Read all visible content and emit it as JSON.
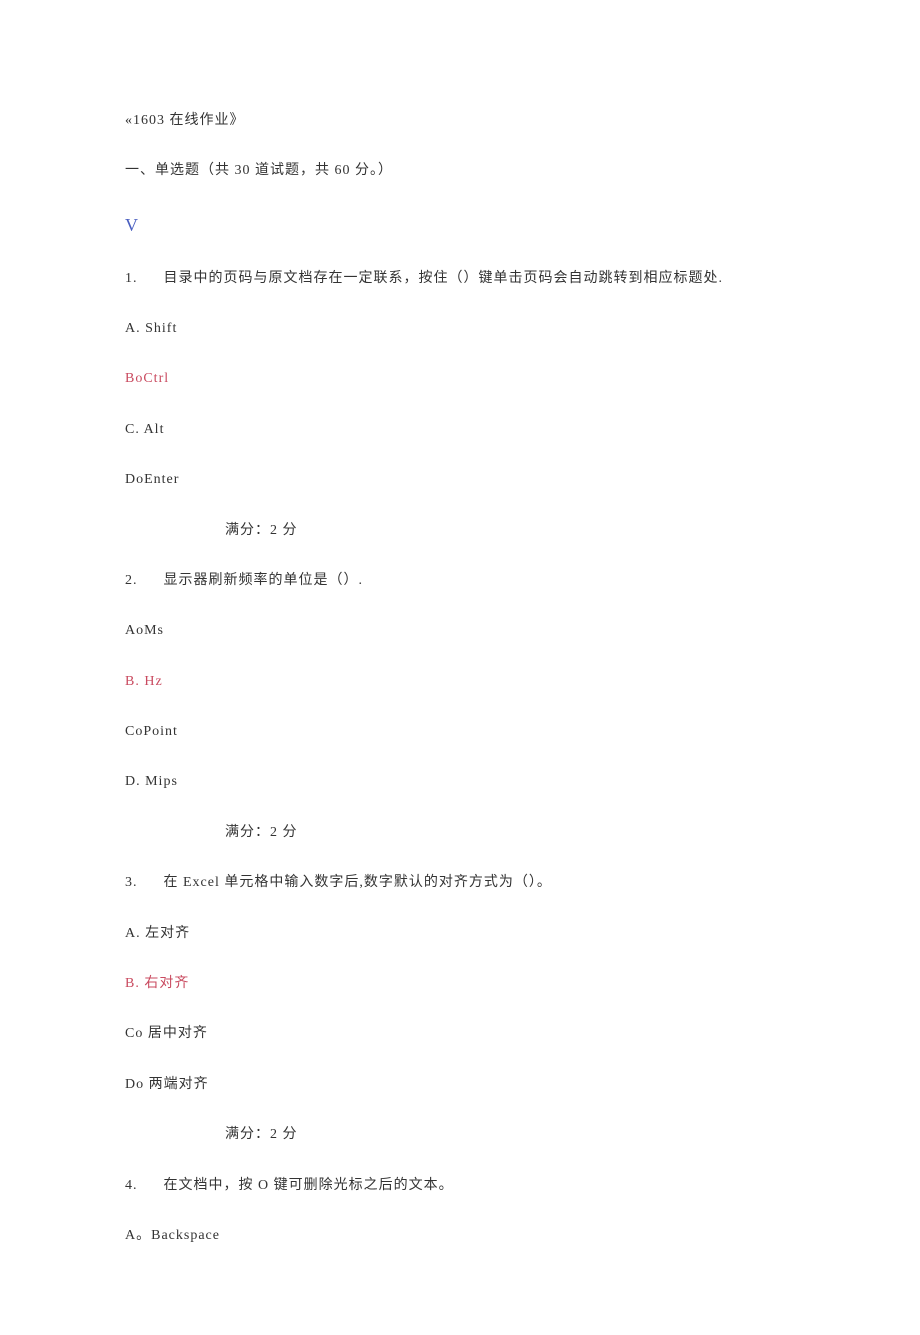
{
  "title": "«1603 在线作业》",
  "section": "一、单选题（共 30 道试题，共 60 分。）",
  "symbol_v": "V",
  "questions": [
    {
      "num": "1.",
      "text": "目录中的页码与原文档存在一定联系，按住（）键单击页码会自动跳转到相应标题处.",
      "opts": [
        {
          "t": "A. Shift",
          "ans": false
        },
        {
          "t": "BoCtrl",
          "ans": true
        },
        {
          "t": "C. Alt",
          "ans": false
        },
        {
          "t": "DoEnter",
          "ans": false
        }
      ],
      "score": "满分：2 分"
    },
    {
      "num": "2.",
      "text": "显示器刷新频率的单位是（）.",
      "opts": [
        {
          "t": "AoMs",
          "ans": false
        },
        {
          "t": "B. Hz",
          "ans": true
        },
        {
          "t": "CoPoint",
          "ans": false
        },
        {
          "t": "D. Mips",
          "ans": false
        }
      ],
      "score": "满分：2 分"
    },
    {
      "num": "3.",
      "text": "在 Excel 单元格中输入数字后,数字默认的对齐方式为（）。",
      "opts": [
        {
          "t": "A. 左对齐",
          "ans": false
        },
        {
          "t": "B. 右对齐",
          "ans": true
        },
        {
          "t": "Co 居中对齐",
          "ans": false
        },
        {
          "t": "Do 两端对齐",
          "ans": false
        }
      ],
      "score": "满分：2 分"
    },
    {
      "num": "4.",
      "text": "在文档中，按 O 键可删除光标之后的文本。",
      "opts": [
        {
          "t": "A。Backspace",
          "ans": false
        }
      ],
      "score": ""
    }
  ]
}
